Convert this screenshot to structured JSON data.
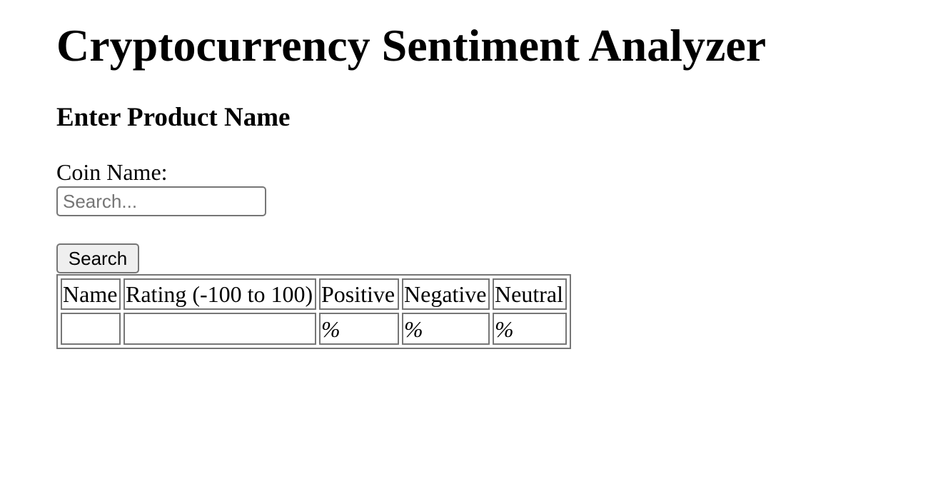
{
  "page": {
    "title": "Cryptocurrency Sentiment Analyzer",
    "subtitle": "Enter Product Name"
  },
  "form": {
    "coin_label": "Coin Name:",
    "search_placeholder": "Search...",
    "search_value": "",
    "search_button_label": "Search"
  },
  "table": {
    "headers": [
      "Name",
      "Rating (-100 to 100)",
      "Positive",
      "Negative",
      "Neutral"
    ],
    "rows": [
      [
        "",
        "",
        "%",
        "%",
        "%"
      ]
    ]
  }
}
